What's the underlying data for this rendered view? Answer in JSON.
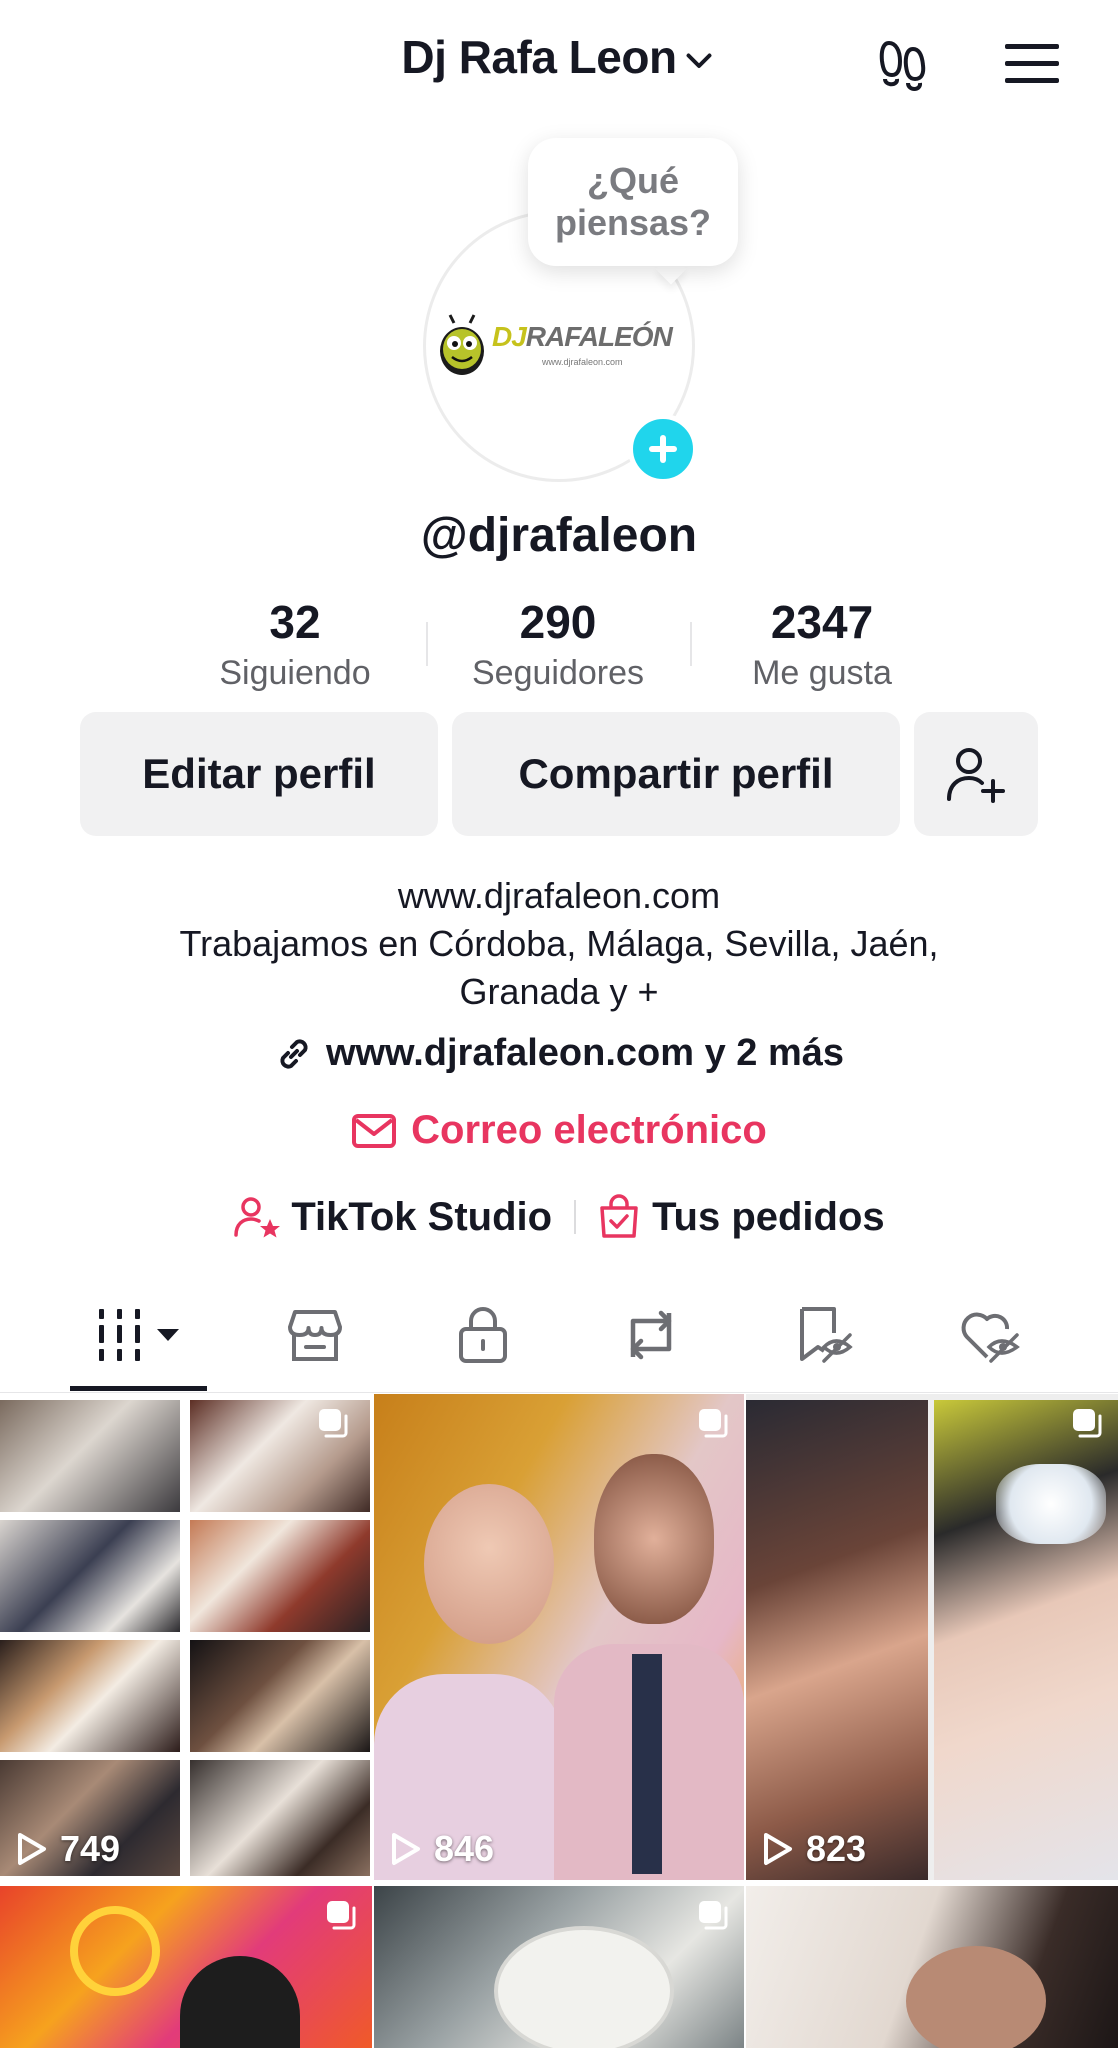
{
  "header": {
    "title": "Dj Rafa Leon",
    "icons": [
      "chevron-down-icon",
      "footprints-icon",
      "menu-icon"
    ]
  },
  "avatar": {
    "logo_text_a": "DJ",
    "logo_text_b": "RAFALEÓN",
    "logo_url": "www.djrafaleon.com",
    "bubble_text": "¿Qué piensas?"
  },
  "profile": {
    "username": "@djrafaleon",
    "stats": [
      {
        "value": "32",
        "label": "Siguiendo"
      },
      {
        "value": "290",
        "label": "Seguidores"
      },
      {
        "value": "2347",
        "label": "Me gusta"
      }
    ]
  },
  "actions": {
    "edit": "Editar perfil",
    "share": "Compartir perfil"
  },
  "bio": {
    "line1": "www.djrafaleon.com",
    "line2": "Trabajamos en Córdoba, Málaga, Sevilla, Jaén,",
    "line3": "Granada y +",
    "link": "www.djrafaleon.com y 2 más",
    "email": "Correo electrónico",
    "studio": "TikTok Studio",
    "orders": "Tus pedidos"
  },
  "tabs": [
    "videos-grid-icon",
    "shop-icon",
    "lock-icon",
    "repost-icon",
    "saved-hidden-icon",
    "liked-hidden-icon"
  ],
  "videos": [
    {
      "views": "749"
    },
    {
      "views": "846"
    },
    {
      "views": "823"
    }
  ],
  "colors": {
    "accent_pink": "#e83560",
    "accent_cyan": "#20d5ec",
    "button_bg": "#f1f1f2"
  }
}
